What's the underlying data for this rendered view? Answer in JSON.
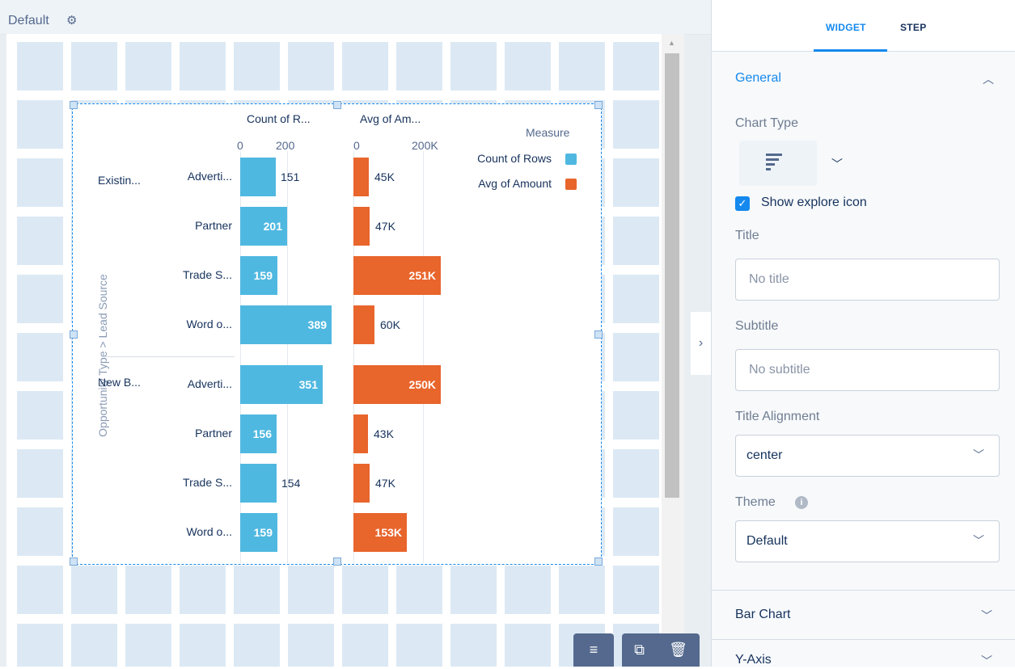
{
  "canvas": {
    "layout_name": "Default",
    "chart": {
      "x_titles": [
        "Count of R...",
        "Avg of Am..."
      ],
      "x_ticks_count": [
        "0",
        "200"
      ],
      "x_ticks_avg": [
        "0",
        "200K"
      ],
      "dimension_title": "Opportunity Type > Lead Source",
      "group_labels": [
        "Existin...",
        "New B..."
      ],
      "row_labels": [
        "Adverti...",
        "Partner",
        "Trade S...",
        "Word o...",
        "Adverti...",
        "Partner",
        "Trade S...",
        "Word o..."
      ],
      "count_labels": [
        "151",
        "201",
        "159",
        "389",
        "351",
        "156",
        "154",
        "159"
      ],
      "avg_labels": [
        "45K",
        "47K",
        "251K",
        "60K",
        "250K",
        "43K",
        "47K",
        "153K"
      ],
      "legend_title": "Measure",
      "legend": [
        "Count of Rows",
        "Avg of Amount"
      ]
    }
  },
  "chart_data": {
    "type": "bar",
    "orientation": "horizontal",
    "title": "",
    "categories": [
      "Existin... > Adverti...",
      "Existin... > Partner",
      "Existin... > Trade S...",
      "Existin... > Word o...",
      "New B... > Adverti...",
      "New B... > Partner",
      "New B... > Trade S...",
      "New B... > Word o..."
    ],
    "series": [
      {
        "name": "Count of Rows",
        "values": [
          151,
          201,
          159,
          389,
          351,
          156,
          154,
          159
        ],
        "color": "#4fb8e0",
        "xlim": [
          0,
          400
        ]
      },
      {
        "name": "Avg of Amount",
        "values": [
          45000,
          47000,
          251000,
          60000,
          250000,
          43000,
          47000,
          153000
        ],
        "color": "#e8652c",
        "xlim": [
          0,
          250000
        ]
      }
    ],
    "legend_position": "right",
    "grid": true
  },
  "toolbar": {
    "icons": [
      "bar-chart-icon",
      "clone-icon",
      "delete-icon"
    ]
  },
  "panel": {
    "tabs": [
      "WIDGET",
      "STEP"
    ],
    "general": {
      "heading": "General",
      "chart_type_label": "Chart Type",
      "explore_label": "Show explore icon",
      "title_label": "Title",
      "title_placeholder": "No title",
      "subtitle_label": "Subtitle",
      "subtitle_placeholder": "No subtitle",
      "alignment_label": "Title Alignment",
      "alignment_value": "center",
      "theme_label": "Theme",
      "theme_value": "Default"
    },
    "sections": [
      "Bar Chart",
      "Y-Axis"
    ],
    "colors": {
      "accent": "#1589ee",
      "count_bar": "#4fb8e0",
      "avg_bar": "#e8652c"
    }
  }
}
